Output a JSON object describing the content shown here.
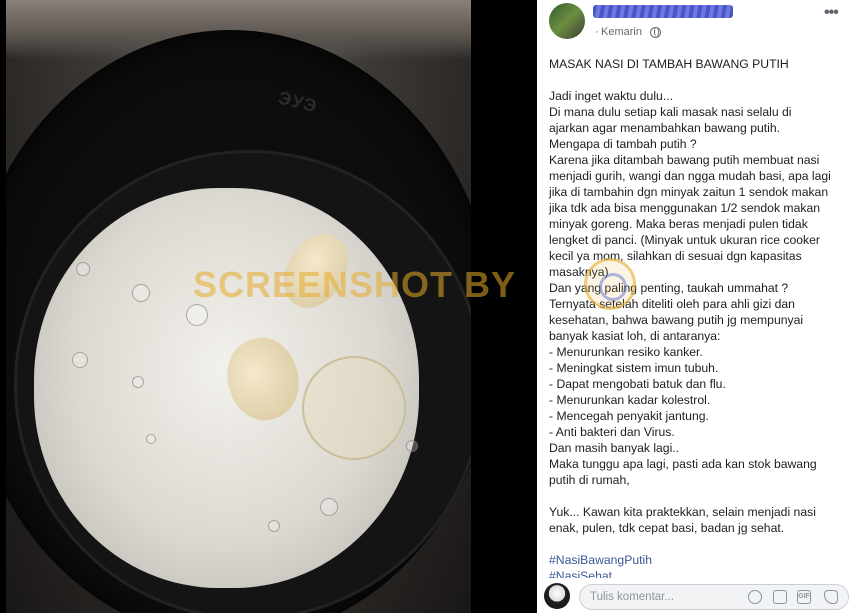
{
  "post": {
    "time": "Kemarin",
    "title": "MASAK NASI DI TAMBAH BAWANG PUTIH",
    "lines": [
      "Jadi inget waktu dulu...",
      "Di mana dulu setiap kali masak nasi selalu di",
      "ajarkan agar menambahkan bawang putih.",
      "Mengapa di tambah putih ?",
      "Karena jika ditambah bawang putih membuat nasi",
      "menjadi gurih, wangi dan ngga mudah basi, apa lagi",
      "jika di tambahin dgn minyak zaitun 1 sendok makan",
      "jika tdk ada bisa menggunakan 1/2 sendok makan",
      "minyak goreng. Maka beras menjadi pulen tidak",
      "lengket di panci. (Minyak untuk ukuran rice cooker",
      "kecil ya mom, silahkan di sesuai dgn kapasitas",
      "masaknya)",
      "Dan yang paling penting, taukah ummahat ?",
      "Ternyata setelah diteliti oleh para ahli gizi dan",
      "kesehatan, bahwa bawang putih jg mempunyai",
      "banyak kasiat loh, di antaranya:",
      "- Menurunkan resiko kanker.",
      "- Meningkat sistem imun tubuh.",
      "- Dapat mengobati batuk dan flu.",
      "- Menurunkan kadar kolestrol.",
      "- Mencegah penyakit jantung.",
      "- Anti bakteri dan Virus.",
      "Dan masih banyak lagi..",
      "Maka tunggu apa lagi, pasti ada kan stok bawang",
      "putih di rumah,",
      "",
      "Yuk... Kawan kita praktekkan, selain menjadi nasi",
      "enak, pulen, tdk cepat basi, badan jg sehat.",
      ""
    ],
    "hashtags": [
      "#NasiBawangPutih",
      "#NasiSehat"
    ]
  },
  "photo": {
    "watermark": "SCREENSHOT BY",
    "pot_text": "ЭУЭ"
  },
  "comment": {
    "placeholder": "Tulis komentar..."
  },
  "icons": {
    "more": "more-options-icon",
    "privacy": "globe-icon",
    "comment_tools": [
      "emoji-icon",
      "camera-icon",
      "gif-icon",
      "sticker-icon"
    ]
  }
}
